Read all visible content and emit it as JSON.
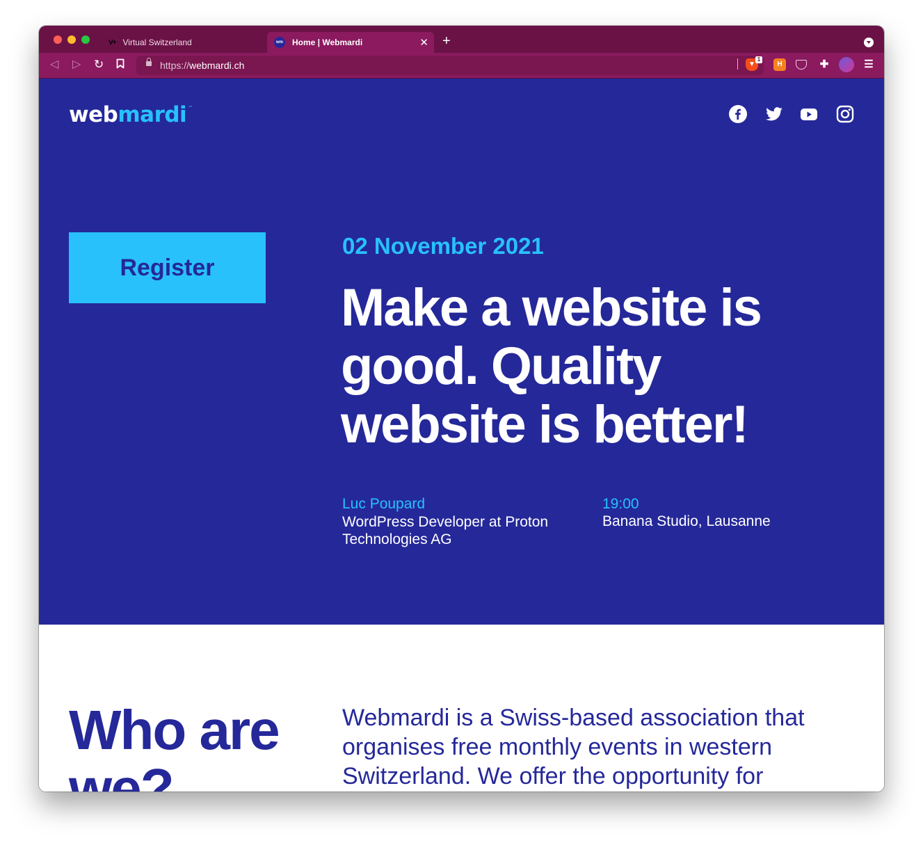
{
  "browser": {
    "tabs": [
      {
        "title": "Virtual Switzerland",
        "favicon": "vs-logo-icon",
        "active": false
      },
      {
        "title": "Home | Webmardi",
        "favicon": "webmardi-favicon-icon",
        "active": true
      }
    ],
    "address_bar": {
      "scheme": "https://",
      "host": "webmardi.ch"
    },
    "brave_shield_count": "1",
    "extensions": [
      "brave-shield-icon",
      "h-extension-icon",
      "pocket-icon",
      "puzzle-icon",
      "profile-avatar",
      "menu-icon"
    ]
  },
  "site": {
    "logo": {
      "part1": "web",
      "part2": "mardi",
      "tm": "™"
    },
    "social": [
      "facebook-icon",
      "twitter-icon",
      "youtube-icon",
      "instagram-icon"
    ],
    "colors": {
      "hero_bg": "#252899",
      "accent": "#28c1fc",
      "text_light": "#ffffff"
    }
  },
  "hero": {
    "register_label": "Register",
    "date": "02 November 2021",
    "headline": "Make a website is good. Quality website is better!",
    "speaker": {
      "name": "Luc Poupard",
      "role": "WordPress Developer at Proton Technologies AG"
    },
    "event": {
      "time": "19:00",
      "venue": "Banana Studio, Lausanne"
    }
  },
  "about": {
    "title": "Who are we?",
    "text": "Webmardi is a Swiss-based association that organises free monthly events in western Switzerland. We offer the opportunity for"
  }
}
